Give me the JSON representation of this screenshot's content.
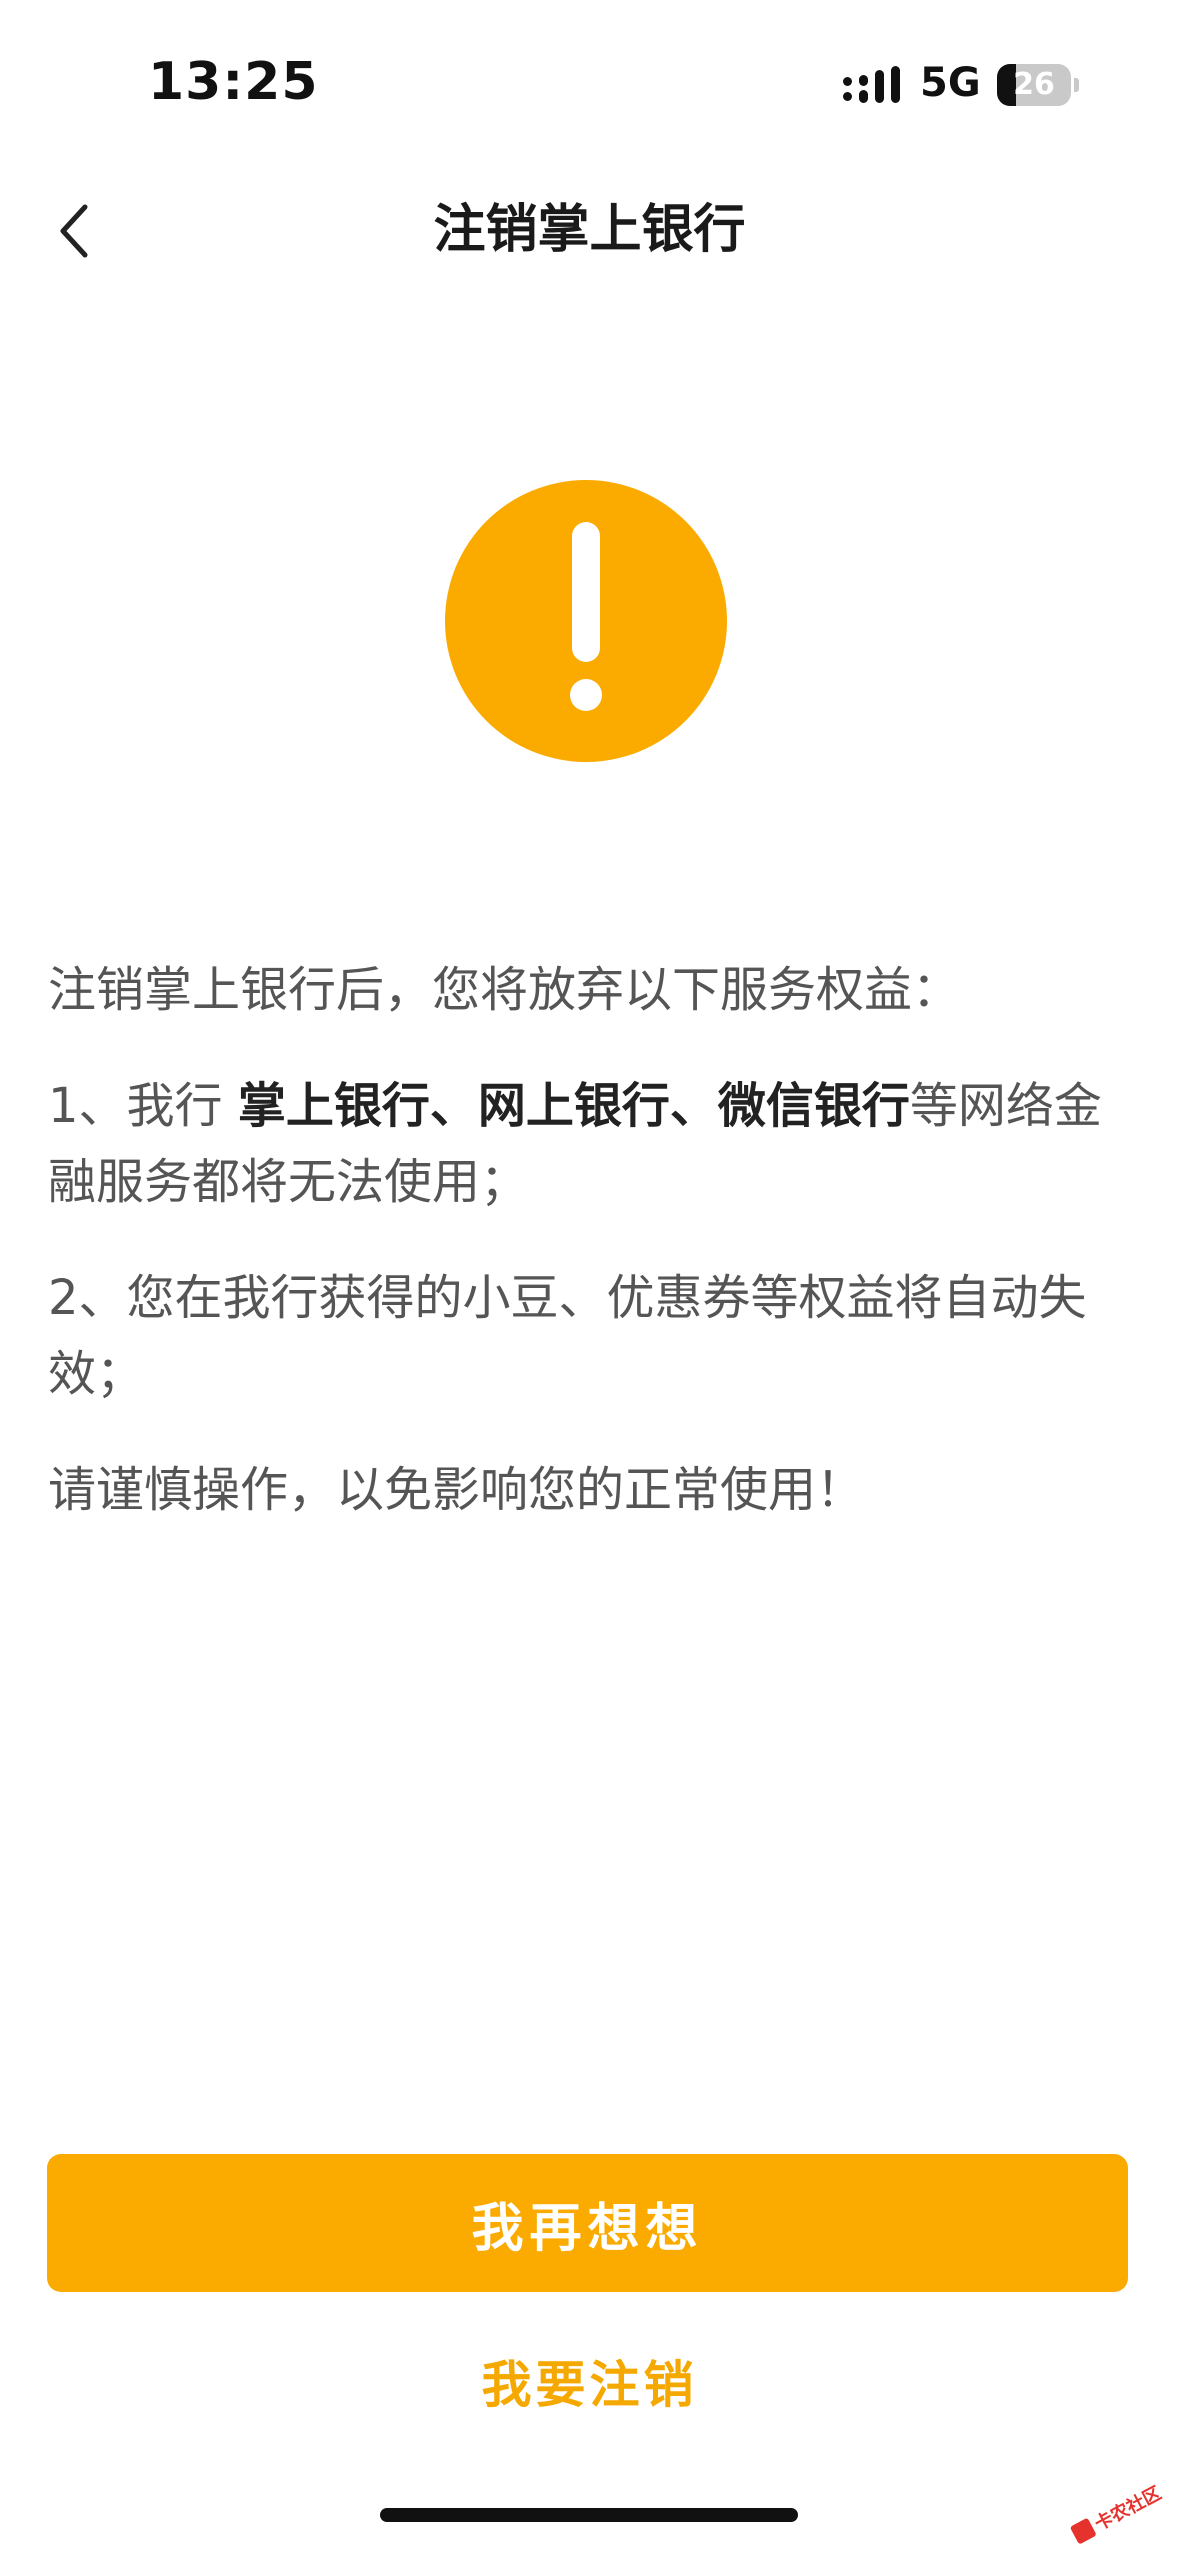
{
  "status_bar": {
    "time": "13:25",
    "network": "5G",
    "battery_level": "26",
    "battery_fraction": 0.26
  },
  "nav": {
    "title": "注销掌上银行",
    "back_icon": "chevron-left-icon"
  },
  "warning": {
    "icon": "exclamation-circle-icon",
    "color": "#fbab00"
  },
  "content": {
    "intro": "注销掌上银行后，您将放弃以下服务权益：",
    "item1": {
      "prefix": "1、我行 ",
      "strong": "掌上银行、网上银行、微信银行",
      "suffix": "等网络金融服务都将无法使用；"
    },
    "item2": "2、您在我行获得的小豆、优惠券等权益将自动失效；",
    "notice": "请谨慎操作，以免影响您的正常使用！"
  },
  "buttons": {
    "primary_label": "我再想想",
    "secondary_label": "我要注销",
    "accent_color": "#fbab00"
  },
  "watermark": {
    "text": "卡农社区"
  }
}
